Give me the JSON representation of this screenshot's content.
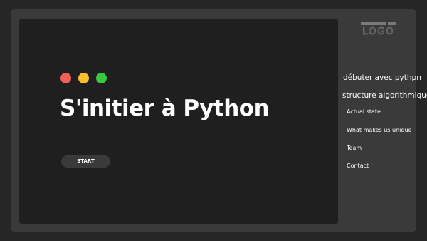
{
  "colors": {
    "background": "#262626",
    "frame": "#3a3a3a",
    "slide": "#1f1f1f",
    "text": "#ffffff",
    "button": "#3a3a3a"
  },
  "window_controls": [
    {
      "name": "close-dot",
      "color": "#f25f58"
    },
    {
      "name": "minimize-dot",
      "color": "#fbbe2e"
    },
    {
      "name": "maximize-dot",
      "color": "#39c840"
    }
  ],
  "slide": {
    "title": "S'initier à Python",
    "start_label": "START"
  },
  "logo": {
    "text": "LOGO"
  },
  "nav": {
    "items": [
      {
        "label": "débuter avec pythpn"
      },
      {
        "label": "structure algorithmique"
      },
      {
        "label": "Actual state"
      },
      {
        "label": "What makes us unique"
      },
      {
        "label": "Team"
      },
      {
        "label": "Contact"
      }
    ]
  }
}
